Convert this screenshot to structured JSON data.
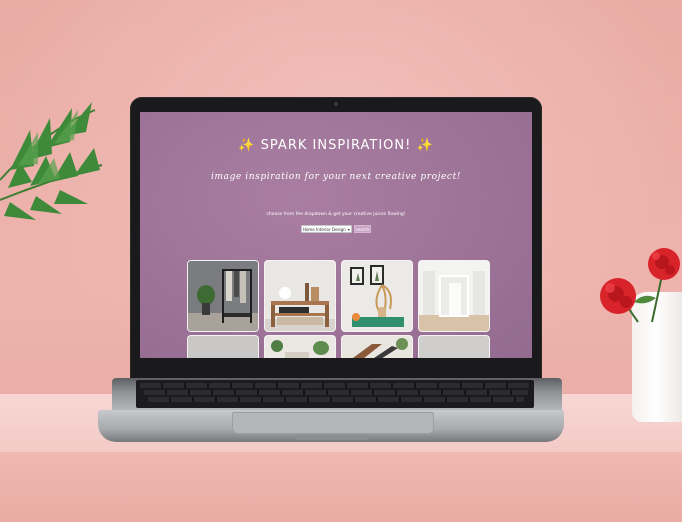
{
  "page": {
    "title": "✨ SPARK INSPIRATION! ✨",
    "tagline": "image inspiration for your next creative project!",
    "instructions": "choose from the dropdown & get your creative juices flowing!",
    "category_select": {
      "selected": "Home Interior Design"
    },
    "search_label": "search",
    "gallery": [
      {
        "icon": "clothing-rack-room-image"
      },
      {
        "icon": "wooden-shelf-decor-image"
      },
      {
        "icon": "gallery-wall-vase-image"
      },
      {
        "icon": "empty-white-room-image"
      },
      {
        "icon": "gray-room-image"
      },
      {
        "icon": "living-room-plant-image"
      },
      {
        "icon": "staircase-image"
      },
      {
        "icon": "gray-wall-image"
      }
    ]
  },
  "colors": {
    "page_background": "#9d7398",
    "search_button": "#c9a4c4",
    "wall": "#eeb3ad",
    "desk": "#f7d6d3",
    "flower": "#e3262b"
  }
}
